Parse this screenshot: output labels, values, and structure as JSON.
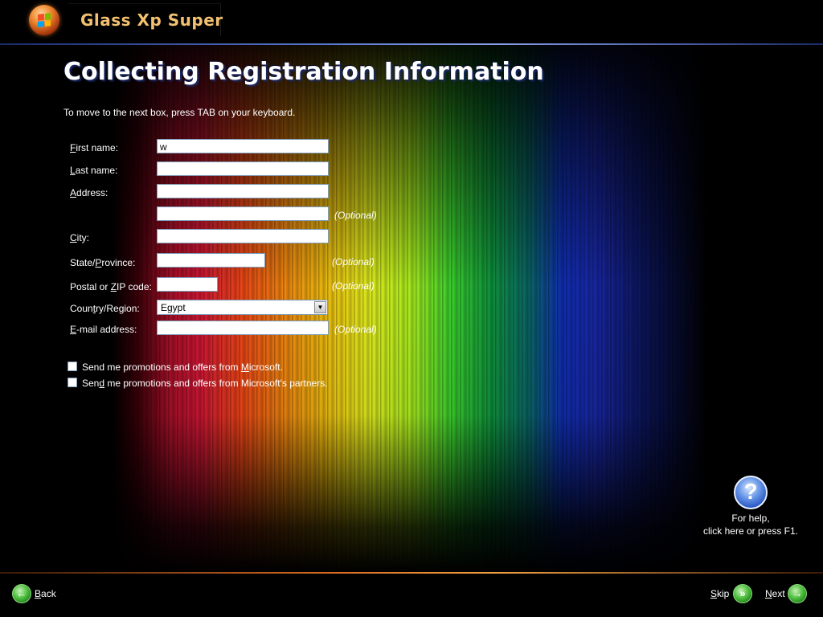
{
  "app": {
    "title": "Glass Xp Super"
  },
  "page": {
    "heading": "Collecting Registration Information",
    "instruction": "To move to the next box, press TAB on your keyboard."
  },
  "form": {
    "first_name": {
      "label_u": "F",
      "label_rest": "irst name:",
      "value": "w"
    },
    "last_name": {
      "label_u": "L",
      "label_rest": "ast name:",
      "value": ""
    },
    "address": {
      "label_u": "A",
      "label_rest": "ddress:",
      "value": "",
      "line2_value": "",
      "line2_note": "(Optional)"
    },
    "city": {
      "label_u": "C",
      "label_rest": "ity:",
      "value": ""
    },
    "state": {
      "label_pre": "State/",
      "label_u": "P",
      "label_rest": "rovince:",
      "value": "",
      "note": "(Optional)"
    },
    "postal": {
      "label_pre": "Postal or ",
      "label_u": "Z",
      "label_rest": "IP code:",
      "value": "",
      "note": "(Optional)"
    },
    "country": {
      "label_pre": "Coun",
      "label_u": "t",
      "label_rest": "ry/Region:",
      "value": "Egypt"
    },
    "email": {
      "label_u": "E",
      "label_rest": "-mail address:",
      "value": "",
      "note": "(Optional)"
    }
  },
  "checkboxes": [
    {
      "pre": "Send me promotions and offers from ",
      "u": "M",
      "rest": "icrosoft.",
      "checked": false
    },
    {
      "pre": "Sen",
      "u": "d",
      "rest": " me promotions and offers from Microsoft's partners.",
      "checked": false
    }
  ],
  "help": {
    "line1": "For help,",
    "line2": "click here or press F1."
  },
  "nav": {
    "back": {
      "u": "B",
      "rest": "ack"
    },
    "skip": {
      "u": "S",
      "rest": "kip"
    },
    "next": {
      "u": "N",
      "rest": "ext"
    }
  },
  "colors": {
    "title_accent": "#f2c070",
    "field_border": "#7f9db9",
    "nav_button": "#50c040",
    "help_icon": "#2050c0"
  }
}
